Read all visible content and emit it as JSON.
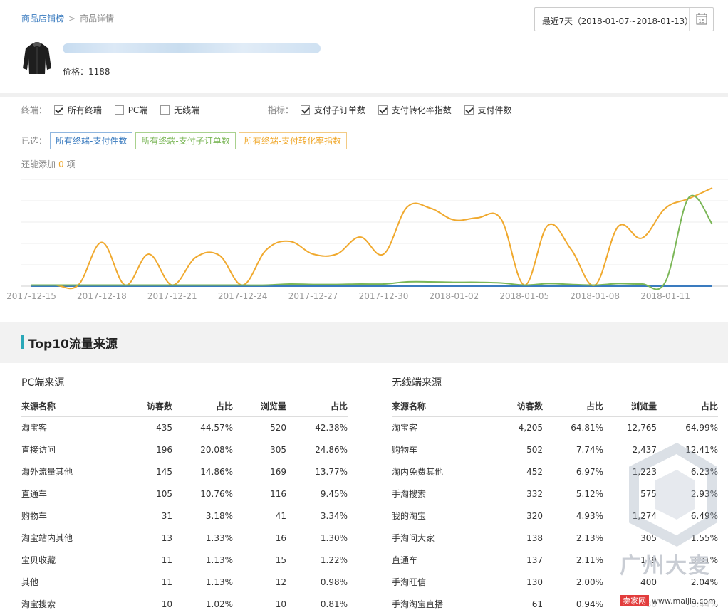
{
  "breadcrumb": {
    "parent": "商品店铺榜",
    "separator": ">",
    "current": "商品详情"
  },
  "date_range": {
    "label": "最近7天（2018-01-07~2018-01-13）",
    "calendar_day": "15"
  },
  "product": {
    "price": "价格：1188"
  },
  "filters": {
    "terminal_label": "终端：",
    "terminals": [
      {
        "label": "所有终端",
        "checked": true
      },
      {
        "label": "PC端",
        "checked": false
      },
      {
        "label": "无线端",
        "checked": false
      }
    ],
    "metric_label": "指标：",
    "metrics": [
      {
        "label": "支付子订单数",
        "checked": true
      },
      {
        "label": "支付转化率指数",
        "checked": true
      },
      {
        "label": "支付件数",
        "checked": true
      }
    ],
    "selected_label": "已选：",
    "selected": [
      {
        "label": "所有终端-支付件数",
        "color": "#3a7bbf"
      },
      {
        "label": "所有终端-支付子订单数",
        "color": "#7ab656"
      },
      {
        "label": "所有终端-支付转化率指数",
        "color": "#f0a92e"
      }
    ],
    "remain_prefix": "还能添加",
    "remain_count": "0",
    "remain_suffix": "项"
  },
  "chart_data": {
    "type": "line",
    "x_tick_labels": [
      "2017-12-15",
      "2017-12-18",
      "2017-12-21",
      "2017-12-24",
      "2017-12-27",
      "2017-12-30",
      "2018-01-02",
      "2018-01-05",
      "2018-01-08",
      "2018-01-11"
    ],
    "x": [
      "2017-12-15",
      "2017-12-16",
      "2017-12-17",
      "2017-12-18",
      "2017-12-19",
      "2017-12-20",
      "2017-12-21",
      "2017-12-22",
      "2017-12-23",
      "2017-12-24",
      "2017-12-25",
      "2017-12-26",
      "2017-12-27",
      "2017-12-28",
      "2017-12-29",
      "2017-12-30",
      "2017-12-31",
      "2018-01-01",
      "2018-01-02",
      "2018-01-03",
      "2018-01-04",
      "2018-01-05",
      "2018-01-06",
      "2018-01-07",
      "2018-01-08",
      "2018-01-09",
      "2018-01-10",
      "2018-01-11",
      "2018-01-12",
      "2018-01-13"
    ],
    "ylim": [
      0,
      5
    ],
    "grid": true,
    "series": [
      {
        "color": "#f0a92e",
        "values": [
          0.05,
          0.05,
          0.05,
          2.05,
          0.05,
          1.5,
          0.05,
          1.35,
          1.45,
          0.05,
          1.7,
          2.1,
          1.5,
          1.5,
          2.3,
          1.5,
          3.7,
          3.65,
          3.1,
          3.2,
          3.15,
          0.05,
          2.85,
          1.7,
          0.05,
          2.8,
          2.25,
          3.65,
          4.1,
          4.6
        ]
      },
      {
        "color": "#7ab656",
        "values": [
          0.05,
          0.05,
          0.05,
          0.05,
          0.05,
          0.05,
          0.05,
          0.05,
          0.05,
          0.05,
          0.05,
          0.1,
          0.08,
          0.08,
          0.1,
          0.1,
          0.2,
          0.2,
          0.18,
          0.18,
          0.15,
          0.05,
          0.12,
          0.08,
          0.05,
          0.12,
          0.1,
          0.2,
          4.15,
          2.9
        ]
      },
      {
        "color": "#3a7bbf",
        "values": [
          0,
          0,
          0,
          0,
          0,
          0,
          0,
          0,
          0,
          0,
          0,
          0,
          0,
          0,
          0,
          0,
          0,
          0,
          0,
          0,
          0,
          0,
          0,
          0,
          0,
          0,
          0,
          0,
          0,
          0
        ]
      }
    ]
  },
  "section_title": "Top10流量来源",
  "pc_table": {
    "title": "PC端来源",
    "headers": [
      "来源名称",
      "访客数",
      "占比",
      "浏览量",
      "占比"
    ],
    "rows": [
      [
        "淘宝客",
        "435",
        "44.57%",
        "520",
        "42.38%"
      ],
      [
        "直接访问",
        "196",
        "20.08%",
        "305",
        "24.86%"
      ],
      [
        "淘外流量其他",
        "145",
        "14.86%",
        "169",
        "13.77%"
      ],
      [
        "直通车",
        "105",
        "10.76%",
        "116",
        "9.45%"
      ],
      [
        "购物车",
        "31",
        "3.18%",
        "41",
        "3.34%"
      ],
      [
        "淘宝站内其他",
        "13",
        "1.33%",
        "16",
        "1.30%"
      ],
      [
        "宝贝收藏",
        "11",
        "1.13%",
        "15",
        "1.22%"
      ],
      [
        "其他",
        "11",
        "1.13%",
        "12",
        "0.98%"
      ],
      [
        "淘宝搜索",
        "10",
        "1.02%",
        "10",
        "0.81%"
      ]
    ]
  },
  "mobile_table": {
    "title": "无线端来源",
    "headers": [
      "来源名称",
      "访客数",
      "占比",
      "浏览量",
      "占比"
    ],
    "rows": [
      [
        "淘宝客",
        "4,205",
        "64.81%",
        "12,765",
        "64.99%"
      ],
      [
        "购物车",
        "502",
        "7.74%",
        "2,437",
        "12.41%"
      ],
      [
        "淘内免费其他",
        "452",
        "6.97%",
        "1,223",
        "6.23%"
      ],
      [
        "手淘搜索",
        "332",
        "5.12%",
        "575",
        "2.93%"
      ],
      [
        "我的淘宝",
        "320",
        "4.93%",
        "1,274",
        "6.49%"
      ],
      [
        "手淘问大家",
        "138",
        "2.13%",
        "305",
        "1.55%"
      ],
      [
        "直通车",
        "137",
        "2.11%",
        "179",
        "0.91%"
      ],
      [
        "手淘旺信",
        "130",
        "2.00%",
        "400",
        "2.04%"
      ],
      [
        "手淘淘宝直播",
        "61",
        "0.94%",
        "86",
        "0.44%"
      ]
    ]
  },
  "watermark": {
    "brand": "广州大麦",
    "site_badge": "卖家网",
    "site": "www.maijia.com"
  }
}
